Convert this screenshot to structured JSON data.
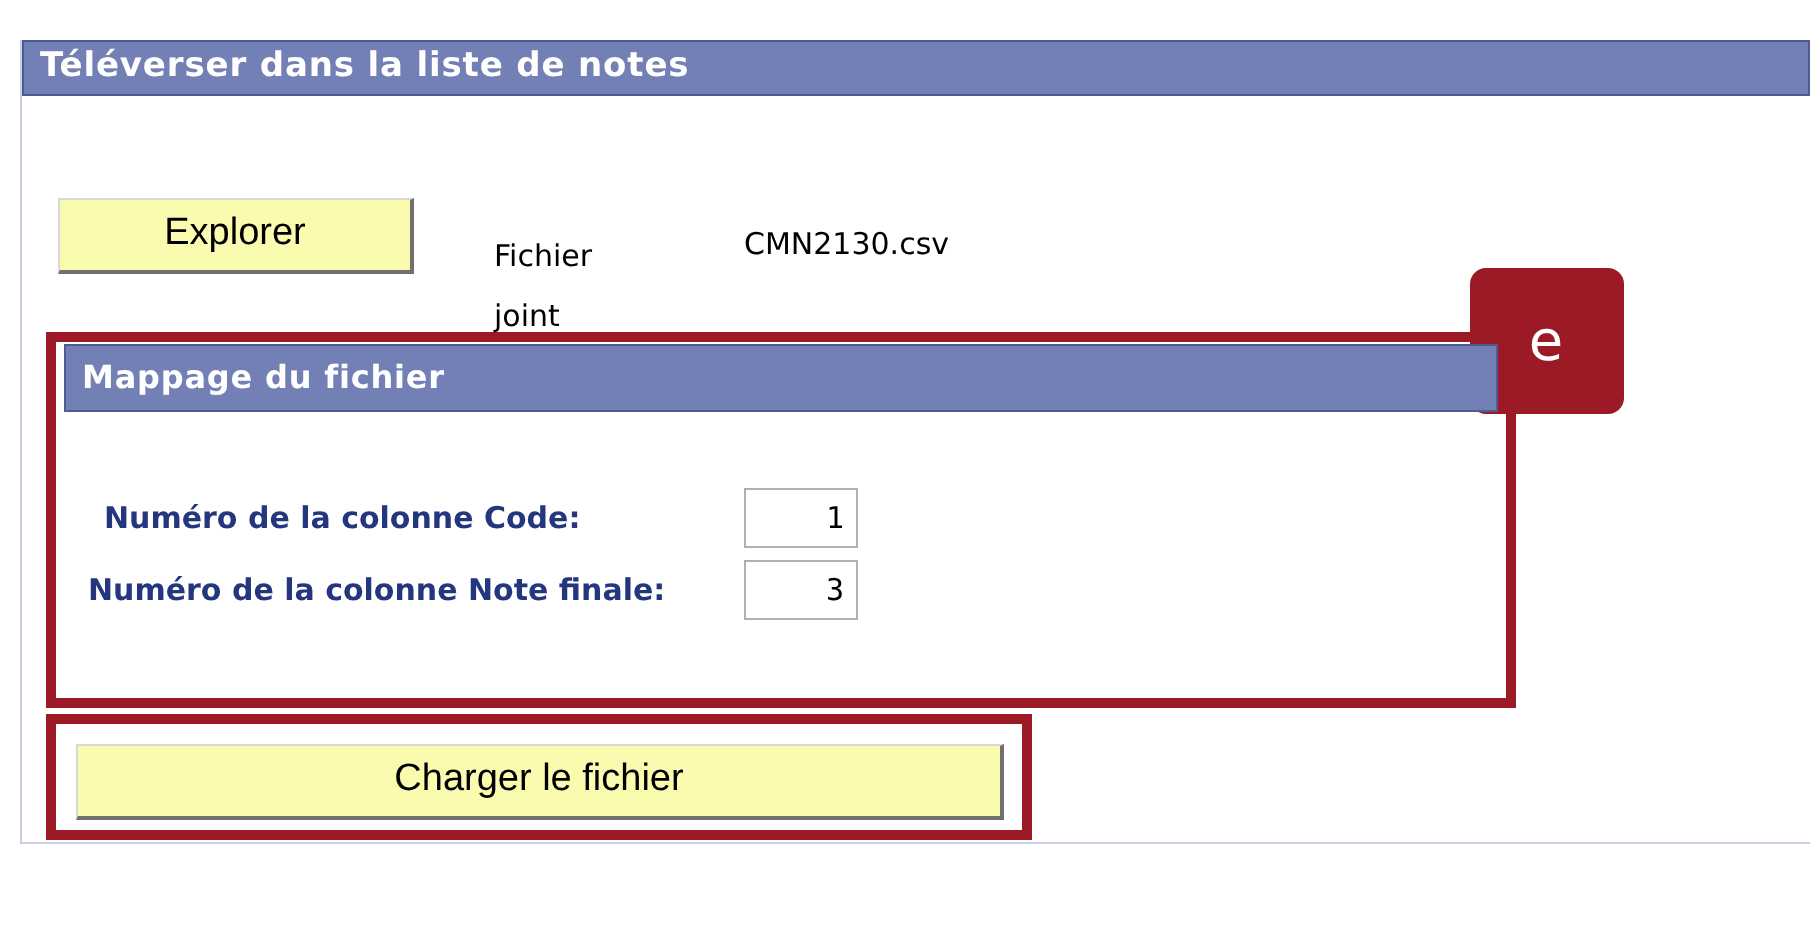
{
  "panel": {
    "title": "Téléverser dans la liste de notes"
  },
  "browse_button": {
    "label": "Explorer"
  },
  "attachment": {
    "label": "Fichier joint",
    "file_name": "CMN2130.csv"
  },
  "callout": {
    "label": "e"
  },
  "mapping": {
    "title": "Mappage du fichier",
    "fields": [
      {
        "label": "Numéro de la colonne Code:",
        "value": "1"
      },
      {
        "label": "Numéro de la colonne Note finale:",
        "value": "3"
      }
    ]
  },
  "upload_button": {
    "label": "Charger le fichier"
  }
}
